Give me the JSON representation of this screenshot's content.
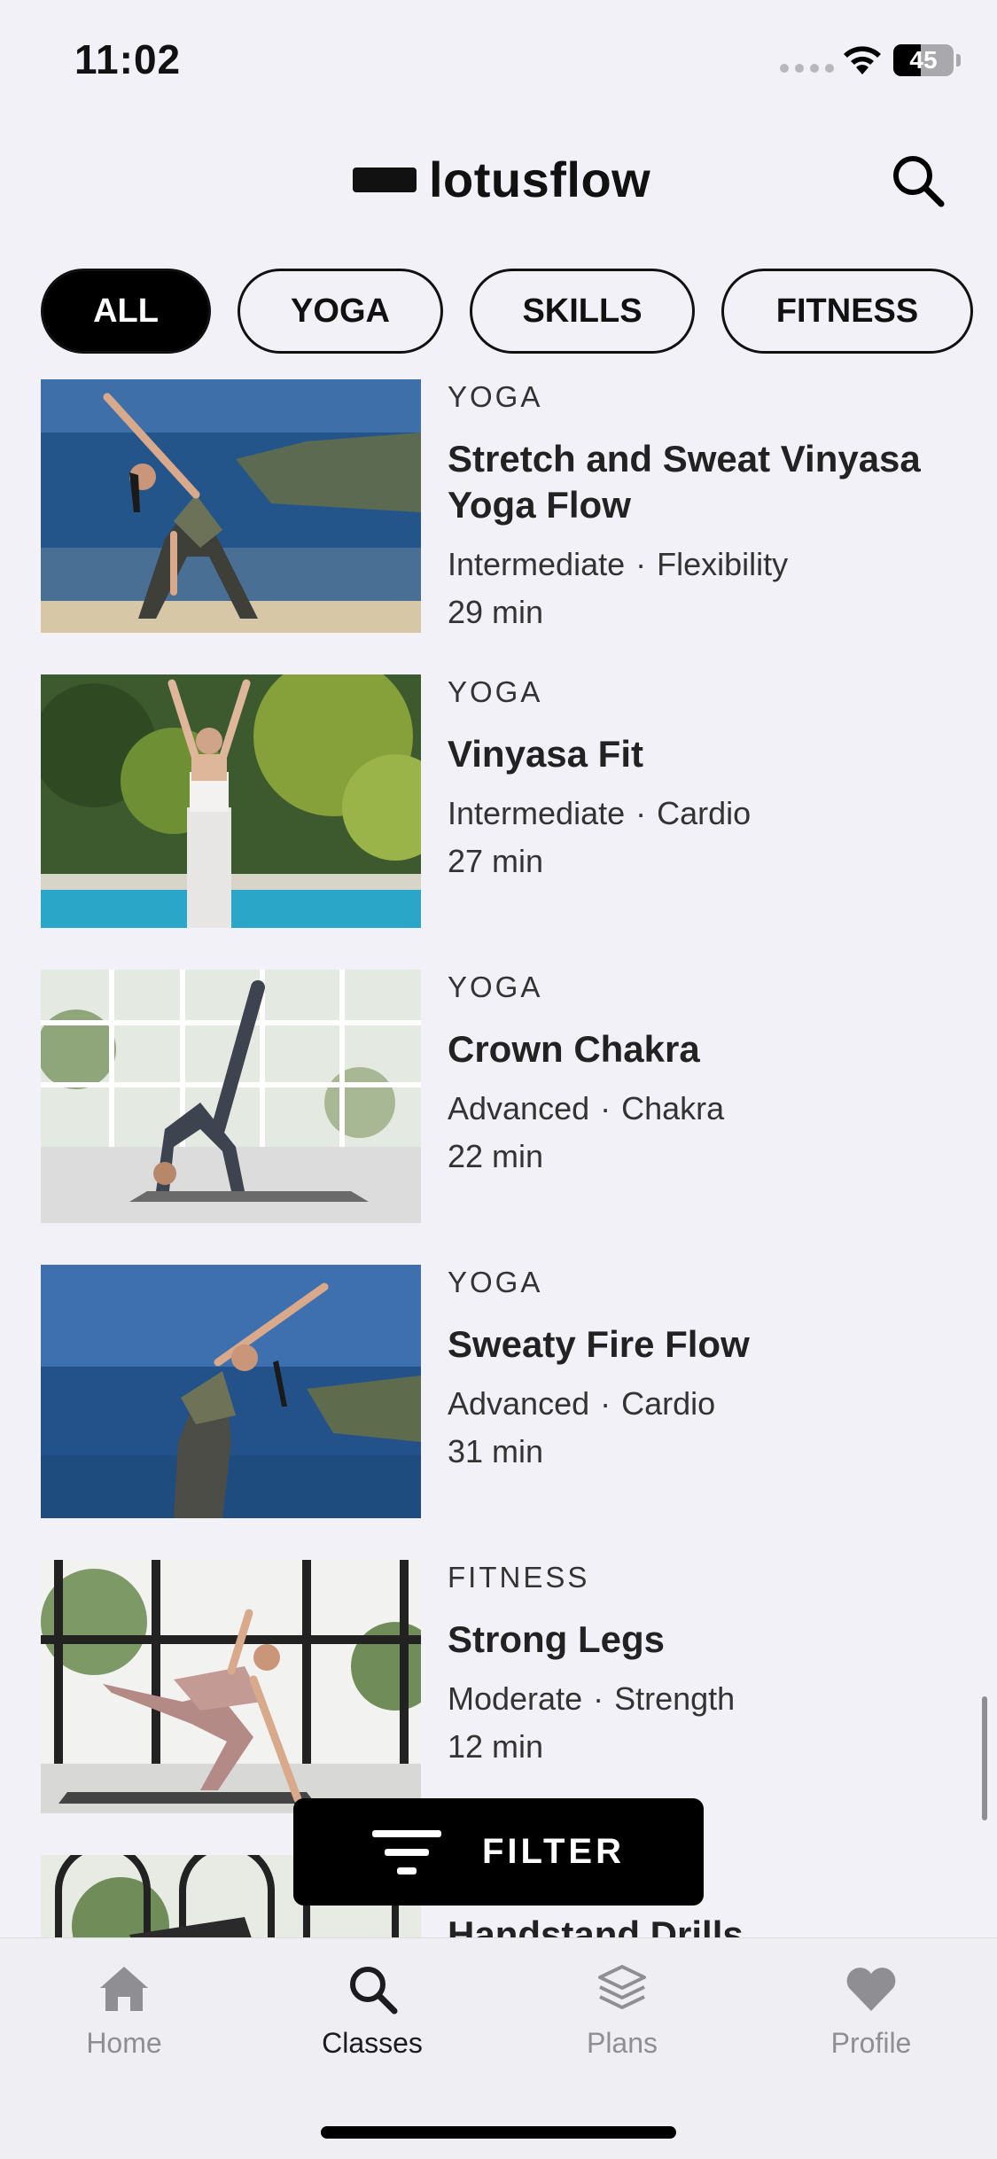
{
  "status_bar": {
    "time": "11:02",
    "battery": "45",
    "battery_level": 0.45
  },
  "header": {
    "logo_text": "lotusflow"
  },
  "chips": [
    {
      "label": "ALL",
      "active": true
    },
    {
      "label": "YOGA",
      "active": false
    },
    {
      "label": "SKILLS",
      "active": false
    },
    {
      "label": "FITNESS",
      "active": false
    }
  ],
  "classes": [
    {
      "category": "YOGA",
      "title": "Stretch and Sweat Vinyasa Yoga Flow",
      "level": "Intermediate",
      "focus": "Flexibility",
      "duration": "29 min"
    },
    {
      "category": "YOGA",
      "title": "Vinyasa Fit",
      "level": "Intermediate",
      "focus": "Cardio",
      "duration": "27 min"
    },
    {
      "category": "YOGA",
      "title": "Crown Chakra",
      "level": "Advanced",
      "focus": "Chakra",
      "duration": "22 min"
    },
    {
      "category": "YOGA",
      "title": "Sweaty Fire Flow",
      "level": "Advanced",
      "focus": "Cardio",
      "duration": "31 min"
    },
    {
      "category": "FITNESS",
      "title": "Strong Legs",
      "level": "Moderate",
      "focus": "Strength",
      "duration": "12 min"
    },
    {
      "category": "",
      "title": "Handstand Drills",
      "level": "",
      "focus": "",
      "duration": ""
    }
  ],
  "filter_button": {
    "label": "FILTER"
  },
  "tabs": [
    {
      "label": "Home",
      "icon": "home-icon",
      "active": false
    },
    {
      "label": "Classes",
      "icon": "search-icon",
      "active": true
    },
    {
      "label": "Plans",
      "icon": "layers-icon",
      "active": false
    },
    {
      "label": "Profile",
      "icon": "heart-icon",
      "active": false
    }
  ],
  "colors": {
    "accent": "#000000",
    "background": "#f2f1f7",
    "inactive_tab": "#8e8e93"
  }
}
